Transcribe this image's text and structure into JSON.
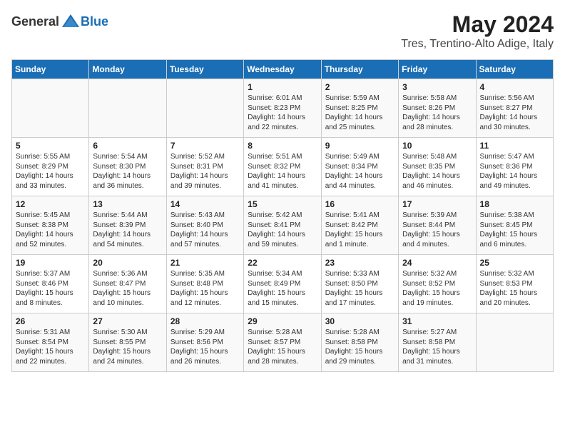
{
  "header": {
    "logo_general": "General",
    "logo_blue": "Blue",
    "month_year": "May 2024",
    "location": "Tres, Trentino-Alto Adige, Italy"
  },
  "weekdays": [
    "Sunday",
    "Monday",
    "Tuesday",
    "Wednesday",
    "Thursday",
    "Friday",
    "Saturday"
  ],
  "weeks": [
    [
      {
        "day": "",
        "text": ""
      },
      {
        "day": "",
        "text": ""
      },
      {
        "day": "",
        "text": ""
      },
      {
        "day": "1",
        "text": "Sunrise: 6:01 AM\nSunset: 8:23 PM\nDaylight: 14 hours\nand 22 minutes."
      },
      {
        "day": "2",
        "text": "Sunrise: 5:59 AM\nSunset: 8:25 PM\nDaylight: 14 hours\nand 25 minutes."
      },
      {
        "day": "3",
        "text": "Sunrise: 5:58 AM\nSunset: 8:26 PM\nDaylight: 14 hours\nand 28 minutes."
      },
      {
        "day": "4",
        "text": "Sunrise: 5:56 AM\nSunset: 8:27 PM\nDaylight: 14 hours\nand 30 minutes."
      }
    ],
    [
      {
        "day": "5",
        "text": "Sunrise: 5:55 AM\nSunset: 8:29 PM\nDaylight: 14 hours\nand 33 minutes."
      },
      {
        "day": "6",
        "text": "Sunrise: 5:54 AM\nSunset: 8:30 PM\nDaylight: 14 hours\nand 36 minutes."
      },
      {
        "day": "7",
        "text": "Sunrise: 5:52 AM\nSunset: 8:31 PM\nDaylight: 14 hours\nand 39 minutes."
      },
      {
        "day": "8",
        "text": "Sunrise: 5:51 AM\nSunset: 8:32 PM\nDaylight: 14 hours\nand 41 minutes."
      },
      {
        "day": "9",
        "text": "Sunrise: 5:49 AM\nSunset: 8:34 PM\nDaylight: 14 hours\nand 44 minutes."
      },
      {
        "day": "10",
        "text": "Sunrise: 5:48 AM\nSunset: 8:35 PM\nDaylight: 14 hours\nand 46 minutes."
      },
      {
        "day": "11",
        "text": "Sunrise: 5:47 AM\nSunset: 8:36 PM\nDaylight: 14 hours\nand 49 minutes."
      }
    ],
    [
      {
        "day": "12",
        "text": "Sunrise: 5:45 AM\nSunset: 8:38 PM\nDaylight: 14 hours\nand 52 minutes."
      },
      {
        "day": "13",
        "text": "Sunrise: 5:44 AM\nSunset: 8:39 PM\nDaylight: 14 hours\nand 54 minutes."
      },
      {
        "day": "14",
        "text": "Sunrise: 5:43 AM\nSunset: 8:40 PM\nDaylight: 14 hours\nand 57 minutes."
      },
      {
        "day": "15",
        "text": "Sunrise: 5:42 AM\nSunset: 8:41 PM\nDaylight: 14 hours\nand 59 minutes."
      },
      {
        "day": "16",
        "text": "Sunrise: 5:41 AM\nSunset: 8:42 PM\nDaylight: 15 hours\nand 1 minute."
      },
      {
        "day": "17",
        "text": "Sunrise: 5:39 AM\nSunset: 8:44 PM\nDaylight: 15 hours\nand 4 minutes."
      },
      {
        "day": "18",
        "text": "Sunrise: 5:38 AM\nSunset: 8:45 PM\nDaylight: 15 hours\nand 6 minutes."
      }
    ],
    [
      {
        "day": "19",
        "text": "Sunrise: 5:37 AM\nSunset: 8:46 PM\nDaylight: 15 hours\nand 8 minutes."
      },
      {
        "day": "20",
        "text": "Sunrise: 5:36 AM\nSunset: 8:47 PM\nDaylight: 15 hours\nand 10 minutes."
      },
      {
        "day": "21",
        "text": "Sunrise: 5:35 AM\nSunset: 8:48 PM\nDaylight: 15 hours\nand 12 minutes."
      },
      {
        "day": "22",
        "text": "Sunrise: 5:34 AM\nSunset: 8:49 PM\nDaylight: 15 hours\nand 15 minutes."
      },
      {
        "day": "23",
        "text": "Sunrise: 5:33 AM\nSunset: 8:50 PM\nDaylight: 15 hours\nand 17 minutes."
      },
      {
        "day": "24",
        "text": "Sunrise: 5:32 AM\nSunset: 8:52 PM\nDaylight: 15 hours\nand 19 minutes."
      },
      {
        "day": "25",
        "text": "Sunrise: 5:32 AM\nSunset: 8:53 PM\nDaylight: 15 hours\nand 20 minutes."
      }
    ],
    [
      {
        "day": "26",
        "text": "Sunrise: 5:31 AM\nSunset: 8:54 PM\nDaylight: 15 hours\nand 22 minutes."
      },
      {
        "day": "27",
        "text": "Sunrise: 5:30 AM\nSunset: 8:55 PM\nDaylight: 15 hours\nand 24 minutes."
      },
      {
        "day": "28",
        "text": "Sunrise: 5:29 AM\nSunset: 8:56 PM\nDaylight: 15 hours\nand 26 minutes."
      },
      {
        "day": "29",
        "text": "Sunrise: 5:28 AM\nSunset: 8:57 PM\nDaylight: 15 hours\nand 28 minutes."
      },
      {
        "day": "30",
        "text": "Sunrise: 5:28 AM\nSunset: 8:58 PM\nDaylight: 15 hours\nand 29 minutes."
      },
      {
        "day": "31",
        "text": "Sunrise: 5:27 AM\nSunset: 8:58 PM\nDaylight: 15 hours\nand 31 minutes."
      },
      {
        "day": "",
        "text": ""
      }
    ]
  ]
}
